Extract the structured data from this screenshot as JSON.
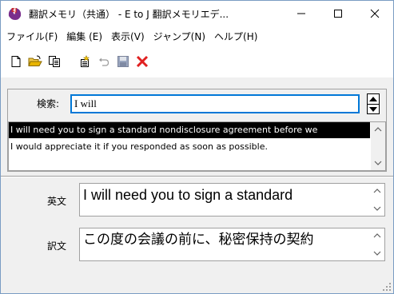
{
  "window": {
    "title": "翻訳メモリ（共通） - E to J 翻訳メモリエデ...",
    "minimize_icon": "minimize-icon",
    "maximize_icon": "maximize-icon",
    "close_icon": "close-icon"
  },
  "menu": {
    "items": [
      {
        "label": "ファイル(F)"
      },
      {
        "label": "編集 (E)"
      },
      {
        "label": "表示(V)"
      },
      {
        "label": "ジャンプ(N)"
      },
      {
        "label": "ヘルプ(H)"
      }
    ]
  },
  "toolbar": {
    "buttons": [
      "new-document-icon",
      "open-folder-icon",
      "copy-icon",
      "new-entry-icon",
      "undo-icon",
      "save-icon",
      "delete-icon"
    ],
    "colors": {
      "delete": "#e02020",
      "open_folder": "#e8b400",
      "save": "#3a5fa8"
    }
  },
  "search": {
    "label": "検索:",
    "value": "I will",
    "spinner_icons": [
      "spin-up-icon",
      "spin-down-icon"
    ]
  },
  "results": {
    "rows": [
      {
        "text": "I will need you to sign a standard nondisclosure agreement before we",
        "selected": true
      },
      {
        "text": "I would appreciate it if you responded as soon as possible.",
        "selected": false
      }
    ],
    "colors": {
      "selected_bg": "#000000",
      "selected_fg": "#ffffff"
    }
  },
  "english": {
    "label": "英文",
    "value": "I will need you to sign a standard"
  },
  "translation": {
    "label": "訳文",
    "value": "この度の会議の前に、秘密保持の契約"
  }
}
